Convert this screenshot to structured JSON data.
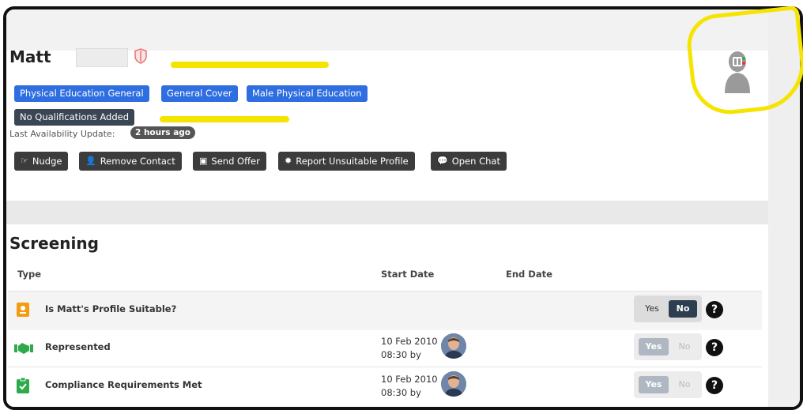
{
  "profile": {
    "first_name": "Matt",
    "tags": [
      "Physical Education General",
      "General Cover",
      "Male Physical Education"
    ],
    "qualifications_tag": "No Qualifications Added",
    "availability_label": "Last Availability Update:",
    "availability_value": "2 hours ago",
    "actions": [
      {
        "label": "Nudge",
        "icon": "hand-point-icon"
      },
      {
        "label": "Remove Contact",
        "icon": "remove-user-icon"
      },
      {
        "label": "Send Offer",
        "icon": "briefcase-icon"
      },
      {
        "label": "Report Unsuitable Profile",
        "icon": "bug-icon"
      },
      {
        "label": "Open Chat",
        "icon": "chat-icon"
      }
    ]
  },
  "screening": {
    "title": "Screening",
    "columns": {
      "type": "Type",
      "start_date": "Start Date",
      "end_date": "End Date"
    },
    "rows": [
      {
        "label": "Is Matt's Profile Suitable?",
        "icon": "id-badge-icon",
        "icon_color": "#f39c12",
        "start_date": "",
        "start_time": "",
        "yes": "Yes",
        "no": "No",
        "selected": "No",
        "enabled": true
      },
      {
        "label": "Represented",
        "icon": "handshake-icon",
        "icon_color": "#2eaa4a",
        "start_date": "10 Feb 2010",
        "start_time": "08:30 by",
        "yes": "Yes",
        "no": "No",
        "selected": "Yes",
        "enabled": false
      },
      {
        "label": "Compliance Requirements Met",
        "icon": "clipboard-check-icon",
        "icon_color": "#2eaa4a",
        "start_date": "10 Feb 2010",
        "start_time": "08:30 by",
        "yes": "Yes",
        "no": "No",
        "selected": "Yes",
        "enabled": false
      }
    ]
  },
  "colors": {
    "tag_blue": "#2e6ee0",
    "tag_dark": "#3a4653",
    "button_dark": "#3c3c3c",
    "highlight_yellow": "#f5e400"
  }
}
